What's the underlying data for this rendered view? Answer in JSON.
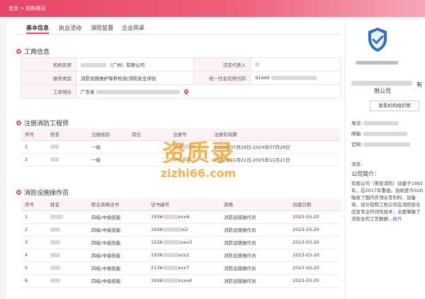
{
  "breadcrumb": {
    "home": "首页",
    "sep": ">",
    "current": "机构概况"
  },
  "tabs": [
    "基本信息",
    "执业活动",
    "消防监督",
    "企业风采"
  ],
  "business": {
    "title": "工商信息",
    "org_name_label": "机构名称",
    "org_name_suffix": "（广州）有限公司",
    "legal_rep_label": "法定代表人",
    "service_label": "服务类型",
    "service_value": "消防设施维护保养检测/消防安全评估",
    "credit_code_label": "统一社会信用代码",
    "credit_code_prefix": "91440",
    "address_label": "工商地址",
    "address_prefix": "广东省"
  },
  "engineers": {
    "title": "注册消防工程师",
    "headers": [
      "序号",
      "姓名",
      "注册级别",
      "岗位",
      "注册号",
      "注册有效期"
    ],
    "rows": [
      {
        "no": "1",
        "level": "一级",
        "reg": "144",
        "period": "2021年07月28日-2024年07月28日"
      },
      {
        "no": "2",
        "level": "一级",
        "reg": "144  031",
        "period": "2022年11月21日-2025年11月21日"
      }
    ]
  },
  "operators": {
    "title": "消防设施操作员",
    "headers": [
      "序号",
      "姓名",
      "职业资格证书",
      "证书编号",
      "资格",
      "创建日期"
    ],
    "rows": [
      {
        "no": "1",
        "cert": "四级/中级技能",
        "code_a": "1936",
        "code_b": "xxx6",
        "qual": "消防设施操作员",
        "date": "2023-03-20"
      },
      {
        "no": "2",
        "cert": "四级/中级技能",
        "code_a": "1936",
        "code_b": "x2",
        "qual": "消防设施操作员",
        "date": "2023-03-20"
      },
      {
        "no": "3",
        "cert": "四级/中级技能",
        "code_a": "1536",
        "code_b": "xxx3",
        "qual": "消防设施操作员",
        "date": "2023-03-20"
      },
      {
        "no": "4",
        "cert": "四级/中级技能",
        "code_a": "1936",
        "code_b": "xxx2",
        "qual": "消防设施操作员",
        "date": "2023-03-20"
      },
      {
        "no": "5",
        "cert": "四级/中级技能",
        "code_a": "2136",
        "code_b": "xxx7",
        "qual": "消防设施操作员",
        "date": "2023-03-20"
      },
      {
        "no": "6",
        "cert": "四级/中级技能",
        "code_a": "1836",
        "code_b": "xxxx4",
        "qual": "消防设施操作员",
        "date": "2023-03-20"
      }
    ]
  },
  "watermark": {
    "main": "资质录",
    "url": "zizhi66.com"
  },
  "sidebar": {
    "company_line": "限公司",
    "you": "有",
    "view_chart_button": "查看机构组织图",
    "phone_label": "电话:",
    "email_label": "邮箱:",
    "website_label": "官网:",
    "browse_label": "浏览:",
    "intro_title": "公司简介：",
    "intro_text": "有限公司（美安消防）创建于1992年，在2017年重组。自始至今SSD吸收了国内外顶尖专利科、设备商，设计院和工程公司在消防安全应急专业的领先技术，全面掌握了消安全的工艺数据...",
    "more": "展开"
  },
  "colors": {
    "accent": "#e84567",
    "header_bg": "#fdf2f4",
    "watermark": "#f39816"
  }
}
